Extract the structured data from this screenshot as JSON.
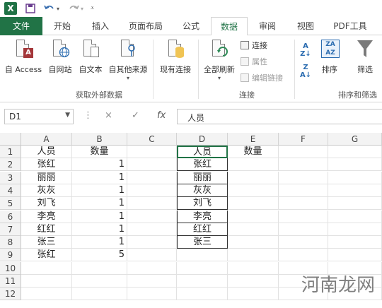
{
  "quick_access": {
    "app_icon": "X",
    "save_icon": "save-icon",
    "undo_icon": "undo-icon",
    "redo_icon": "redo-icon"
  },
  "tabs": [
    {
      "label": "文件"
    },
    {
      "label": "开始"
    },
    {
      "label": "插入"
    },
    {
      "label": "页面布局"
    },
    {
      "label": "公式"
    },
    {
      "label": "数据"
    },
    {
      "label": "审阅"
    },
    {
      "label": "视图"
    },
    {
      "label": "PDF工具"
    }
  ],
  "ribbon": {
    "from_access": "自 Access",
    "from_web": "自网站",
    "from_text": "自文本",
    "from_other": "自其他来源",
    "existing_connections": "现有连接",
    "refresh_all": "全部刷新",
    "connections": "连接",
    "properties": "属性",
    "edit_links": "编辑链接",
    "sort": "排序",
    "filter": "筛选",
    "group_external": "获取外部数据",
    "group_connections": "连接",
    "group_sort": "排序和筛选"
  },
  "formula_bar": {
    "name_box": "D1",
    "cancel_symbol": "×",
    "enter_symbol": "✓",
    "fx_symbol": "fx",
    "formula": "人员"
  },
  "columns": [
    "A",
    "B",
    "C",
    "D",
    "E",
    "F",
    "G"
  ],
  "rows": [
    "1",
    "2",
    "3",
    "4",
    "5",
    "6",
    "7",
    "8",
    "9",
    "10",
    "11",
    "12"
  ],
  "cells": {
    "A": [
      "人员",
      "张红",
      "丽丽",
      "灰灰",
      "刘飞",
      "李亮",
      "红红",
      "张三",
      "张红"
    ],
    "B": [
      "数量",
      "1",
      "1",
      "1",
      "1",
      "1",
      "1",
      "1",
      "5"
    ],
    "D": [
      "人员",
      "张红",
      "丽丽",
      "灰灰",
      "刘飞",
      "李亮",
      "红红",
      "张三"
    ],
    "E": [
      "数量"
    ]
  },
  "watermark": "河南龙网",
  "colors": {
    "accent": "#217346"
  }
}
